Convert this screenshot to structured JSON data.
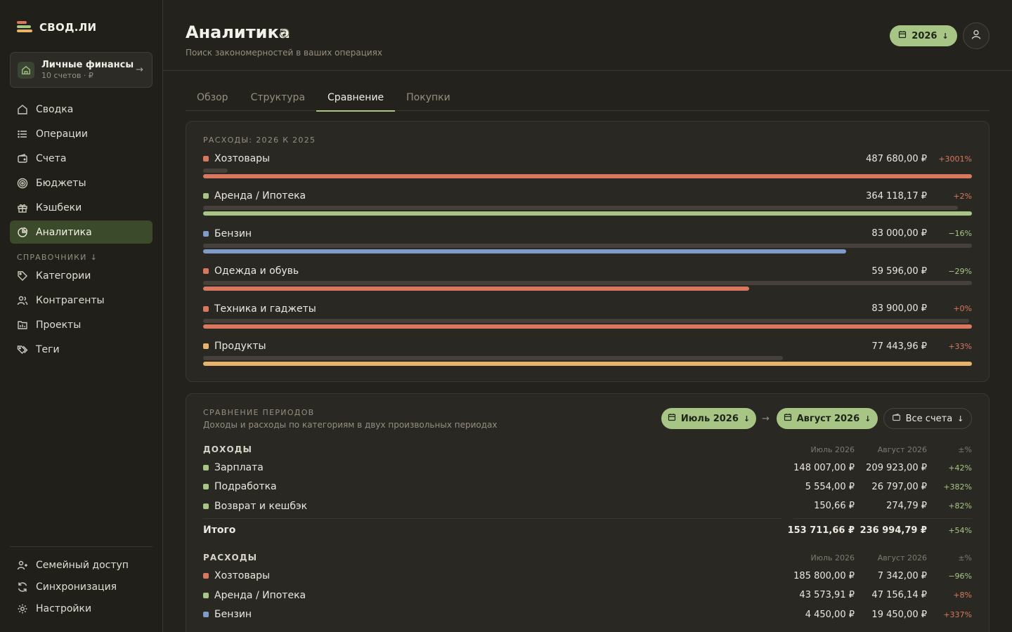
{
  "brand": {
    "name": "СВОД.ЛИ",
    "colors": [
      "#d9785e",
      "#a7c686",
      "#e8b46a"
    ]
  },
  "account": {
    "name": "Личные финансы",
    "sub": "10 счетов · ₽"
  },
  "nav": {
    "main": [
      {
        "label": "Сводка",
        "icon": "home-icon"
      },
      {
        "label": "Операции",
        "icon": "list-icon"
      },
      {
        "label": "Счета",
        "icon": "wallet-icon"
      },
      {
        "label": "Бюджеты",
        "icon": "target-icon"
      },
      {
        "label": "Кэшбеки",
        "icon": "gift-icon"
      },
      {
        "label": "Аналитика",
        "icon": "pie-chart-icon",
        "active": true
      }
    ],
    "section_label": "СПРАВОЧНИКИ",
    "refs": [
      {
        "label": "Категории",
        "icon": "tag-icon"
      },
      {
        "label": "Контрагенты",
        "icon": "users-icon"
      },
      {
        "label": "Проекты",
        "icon": "folder-icon"
      },
      {
        "label": "Теги",
        "icon": "tags-icon"
      }
    ],
    "bottom": [
      {
        "label": "Семейный доступ",
        "icon": "family-icon"
      },
      {
        "label": "Синхронизация",
        "icon": "sync-icon"
      },
      {
        "label": "Настройки",
        "icon": "gear-icon"
      }
    ]
  },
  "header": {
    "title": "Аналитика",
    "subtitle": "Поиск закономерностей в ваших операциях",
    "year": "2026"
  },
  "tabs": [
    {
      "label": "Обзор"
    },
    {
      "label": "Структура"
    },
    {
      "label": "Сравнение",
      "active": true
    },
    {
      "label": "Покупки"
    }
  ],
  "compare_yoy": {
    "label": "РАСХОДЫ: 2026 К 2025",
    "rows": [
      {
        "name": "Хозтовары",
        "amount": "487 680,00 ₽",
        "delta": "+3001%",
        "color": "#d9785e",
        "prev_ratio": 0.032,
        "cur_ratio": 1.0
      },
      {
        "name": "Аренда / Ипотека",
        "amount": "364 118,17 ₽",
        "delta": "+2%",
        "color": "#a7c686",
        "prev_ratio": 0.982,
        "cur_ratio": 1.0
      },
      {
        "name": "Бензин",
        "amount": "83 000,00 ₽",
        "delta": "−16%",
        "color": "#7f9bc9",
        "prev_ratio": 1.0,
        "cur_ratio": 0.836
      },
      {
        "name": "Одежда и обувь",
        "amount": "59 596,00 ₽",
        "delta": "−29%",
        "color": "#d9785e",
        "prev_ratio": 1.0,
        "cur_ratio": 0.71
      },
      {
        "name": "Техника и гаджеты",
        "amount": "83 900,00 ₽",
        "delta": "+0%",
        "color": "#d9785e",
        "prev_ratio": 0.996,
        "cur_ratio": 1.0
      },
      {
        "name": "Продукты",
        "amount": "77 443,96 ₽",
        "delta": "+33%",
        "color": "#e8b46a",
        "prev_ratio": 0.754,
        "cur_ratio": 1.0
      }
    ]
  },
  "periods": {
    "label": "СРАВНЕНИЕ ПЕРИОДОВ",
    "description": "Доходы и расходы по категориям в двух произвольных периодах",
    "period_a": "Июль 2026",
    "period_b": "Август 2026",
    "accounts": "Все счета",
    "col_a": "Июль 2026",
    "col_b": "Август 2026",
    "col_delta": "±%",
    "income_label": "ДОХОДЫ",
    "income": [
      {
        "name": "Зарплата",
        "a": "148 007,00 ₽",
        "b": "209 923,00 ₽",
        "d": "+42%",
        "color": "#a7c686"
      },
      {
        "name": "Подработка",
        "a": "5 554,00 ₽",
        "b": "26 797,00 ₽",
        "d": "+382%",
        "color": "#a7c686"
      },
      {
        "name": "Возврат и кешбэк",
        "a": "150,66 ₽",
        "b": "274,79 ₽",
        "d": "+82%",
        "color": "#a7c686"
      }
    ],
    "income_total": {
      "name": "Итого",
      "a": "153 711,66 ₽",
      "b": "236 994,79 ₽",
      "d": "+54%"
    },
    "expense_label": "РАСХОДЫ",
    "expenses": [
      {
        "name": "Хозтовары",
        "a": "185 800,00 ₽",
        "b": "7 342,00 ₽",
        "d": "−96%",
        "color": "#d9785e"
      },
      {
        "name": "Аренда / Ипотека",
        "a": "43 573,91 ₽",
        "b": "47 156,14 ₽",
        "d": "+8%",
        "color": "#a7c686"
      },
      {
        "name": "Бензин",
        "a": "4 450,00 ₽",
        "b": "19 450,00 ₽",
        "d": "+337%",
        "color": "#7f9bc9"
      }
    ]
  },
  "status_colors": {
    "up": "#d9785e",
    "down": "#a7c686",
    "income_up": "#a7c686"
  }
}
